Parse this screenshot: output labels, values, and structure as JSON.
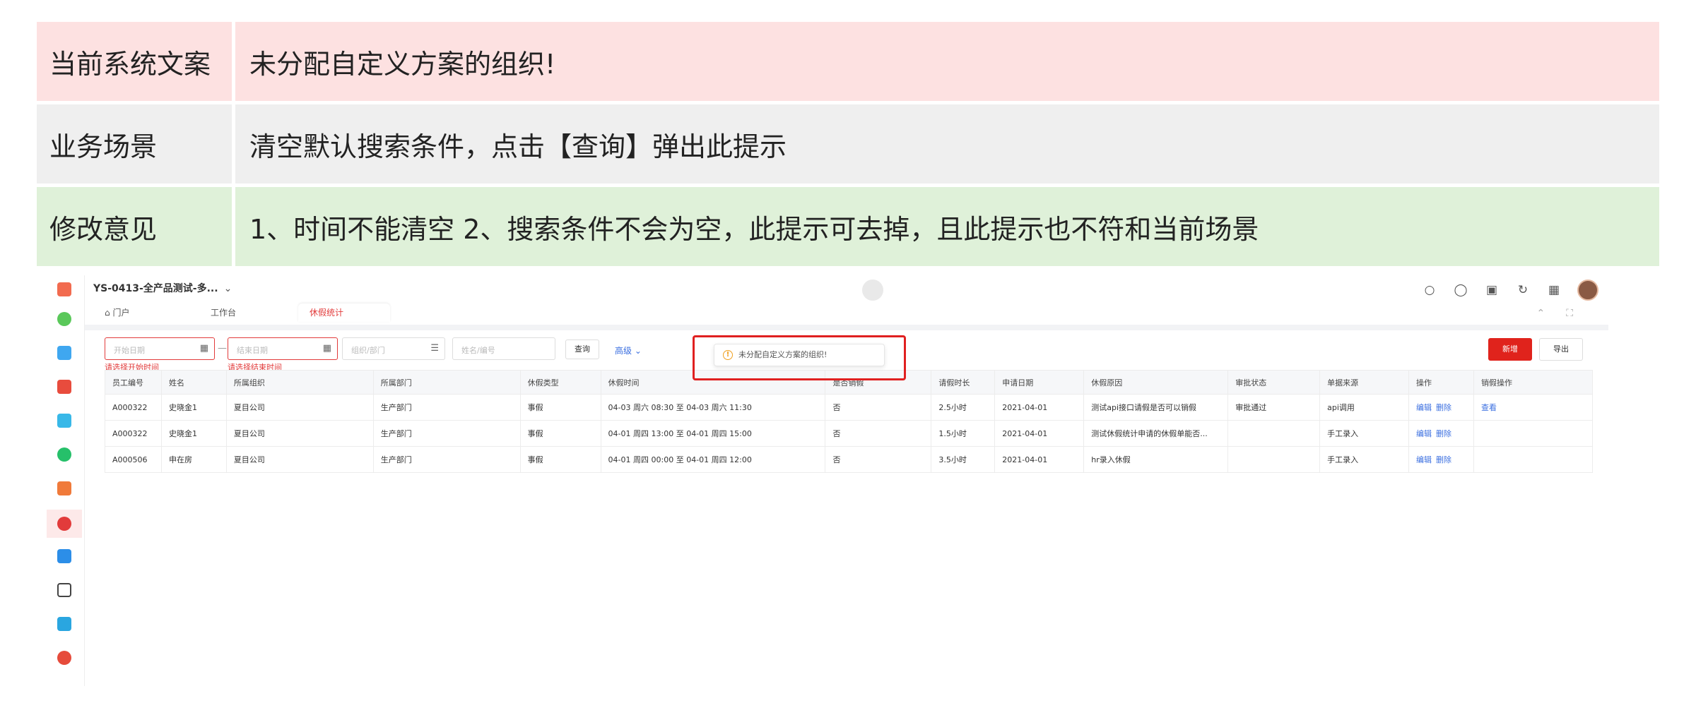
{
  "annotation": {
    "rows": [
      {
        "key": "当前系统文案",
        "value": "未分配自定义方案的组织!"
      },
      {
        "key": "业务场景",
        "value": "清空默认搜索条件，点击【查询】弹出此提示"
      },
      {
        "key": "修改意见",
        "value": "1、时间不能清空 2、搜索条件不会为空，此提示可去掉，且此提示也不符和当前场景"
      }
    ]
  },
  "app": {
    "title": "YS-0413-全产品测试-多...",
    "tabs": [
      "门户",
      "工作台",
      "休假统计"
    ],
    "active_tab": "休假统计",
    "search": {
      "start_placeholder": "开始日期",
      "end_placeholder": "结束日期",
      "org_placeholder": "组织/部门",
      "name_placeholder": "姓名/编号",
      "start_error": "请选择开始时间",
      "end_error": "请选择结束时间",
      "query_label": "查询",
      "advanced_label": "高级",
      "add_label": "新增",
      "export_label": "导出"
    },
    "toast": {
      "message": "未分配自定义方案的组织!"
    },
    "table": {
      "columns": [
        "员工编号",
        "姓名",
        "所属组织",
        "所属部门",
        "休假类型",
        "休假时间",
        "是否销假",
        "请假时长",
        "申请日期",
        "休假原因",
        "审批状态",
        "单据来源",
        "操作",
        "销假操作"
      ],
      "rows": [
        [
          "A000322",
          "史晓金1",
          "夏目公司",
          "生产部门",
          "事假",
          "04-03 周六 08:30 至 04-03 周六 11:30",
          "否",
          "2.5小时",
          "2021-04-01",
          "测试api接口请假是否可以销假",
          "审批通过",
          "api调用"
        ],
        [
          "A000322",
          "史晓金1",
          "夏目公司",
          "生产部门",
          "事假",
          "04-01 周四 13:00 至 04-01 周四 15:00",
          "否",
          "1.5小时",
          "2021-04-01",
          "测试休假统计申请的休假单能否...",
          "",
          "手工录入"
        ],
        [
          "A000506",
          "申在房",
          "夏目公司",
          "生产部门",
          "事假",
          "04-01 周四 00:00 至 04-01 周四 12:00",
          "否",
          "3.5小时",
          "2021-04-01",
          "hr录入休假",
          "",
          "手工录入"
        ]
      ],
      "action_edit": "编辑",
      "action_delete": "删除",
      "action_view": "查看"
    }
  }
}
